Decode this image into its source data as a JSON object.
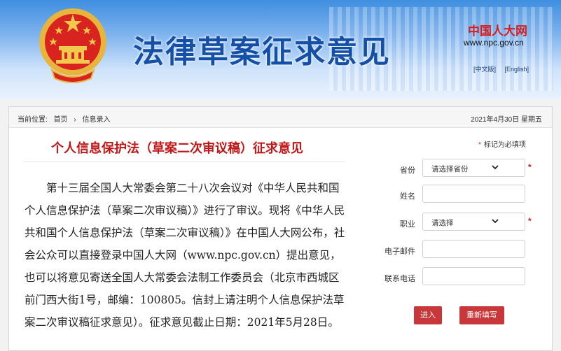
{
  "header": {
    "title": "法律草案征求意见",
    "brand": "中国人大网",
    "url": "www.npc.gov.cn",
    "lang": [
      "[中文版]",
      "[English]"
    ]
  },
  "breadcrumb": {
    "prefix": "当前位置:",
    "home": "首页",
    "separator": "›",
    "current": "信息录入",
    "date": "2021年4月30日  星期五"
  },
  "article": {
    "title": "个人信息保护法（草案二次审议稿）征求意见",
    "body": "第十三届全国人大常委会第二十八次会议对《中华人民共和国个人信息保护法（草案二次审议稿）》进行了审议。现将《中华人民共和国个人信息保护法（草案二次审议稿）》在中国人大网公布，社会公众可以直接登录中国人大网（www.npc.gov.cn）提出意见，也可以将意见寄送全国人大常委会法制工作委员会（北京市西城区前门西大街1号，邮编：100805。信封上请注明个人信息保护法草案二次审议稿征求意见）。征求意见截止日期：2021年5月28日。"
  },
  "form": {
    "required_mark": "*",
    "required_note": "标记为必填项",
    "province": {
      "label": "省份",
      "value": "请选择省份"
    },
    "name": {
      "label": "姓名",
      "value": ""
    },
    "job": {
      "label": "职业",
      "value": "请选择"
    },
    "email": {
      "label": "电子邮件",
      "value": ""
    },
    "phone": {
      "label": "联系电话",
      "value": ""
    },
    "submit_label": "进入",
    "reset_label": "重新填写"
  },
  "colors": {
    "accent": "#c8373a",
    "title_red": "#c01818",
    "header_blue": "#1450a8"
  }
}
